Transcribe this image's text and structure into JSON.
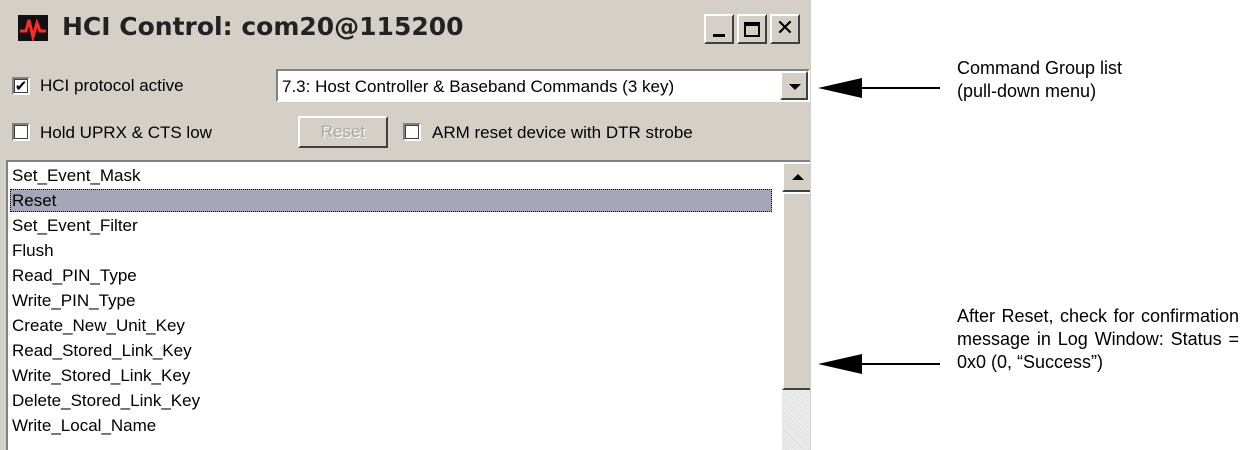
{
  "window": {
    "title": "HCI Control: com20@115200",
    "icon": "waveform-icon",
    "controls": {
      "minimize": "_",
      "maximize": "☐",
      "close": "✕"
    }
  },
  "options": {
    "hci_protocol_active": {
      "label": "HCI protocol active",
      "checked": true
    },
    "hold_uprx_cts_low": {
      "label": "Hold UPRX & CTS low",
      "checked": false
    },
    "reset_button": {
      "label": "Reset",
      "enabled": false
    },
    "arm_reset": {
      "label": "ARM reset device with DTR strobe",
      "checked": false
    }
  },
  "command_group": {
    "selected": "7.3: Host Controller & Baseband Commands (3 key)"
  },
  "command_list": {
    "items": [
      "Set_Event_Mask",
      "Reset",
      "Set_Event_Filter",
      "Flush",
      "Read_PIN_Type",
      "Write_PIN_Type",
      "Create_New_Unit_Key",
      "Read_Stored_Link_Key",
      "Write_Stored_Link_Key",
      "Delete_Stored_Link_Key",
      "Write_Local_Name"
    ],
    "selected_index": 1
  },
  "annotations": {
    "command_group_line1": "Command Group list",
    "command_group_line2": "(pull-down menu)",
    "after_reset": "After Reset, check for confirmation message in Log Window: Status = 0x0 (0, “Success”)"
  }
}
